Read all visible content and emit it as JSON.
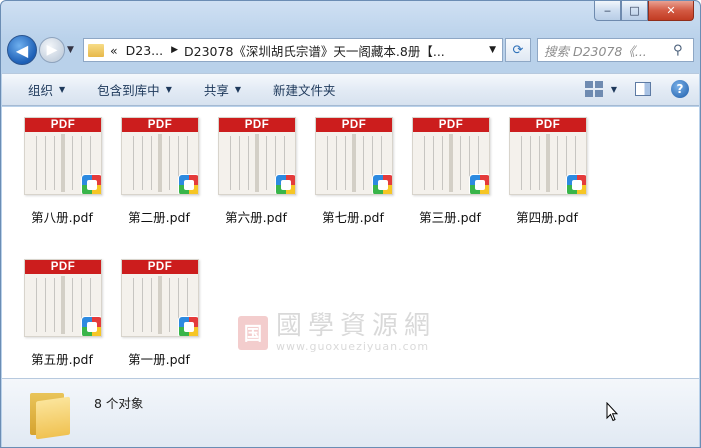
{
  "window": {
    "controls": {
      "minimize": "‒",
      "maximize": "□",
      "close": "✕"
    }
  },
  "navigation": {
    "back_icon": "back-arrow-icon",
    "forward_icon": "forward-arrow-icon",
    "breadcrumb": [
      {
        "label": "«"
      },
      {
        "label": "D23..."
      },
      {
        "label": "D23078《深圳胡氏宗谱》天一阁藏本.8册【..."
      }
    ],
    "search_placeholder": "搜索 D23078《..."
  },
  "toolbar": {
    "items": [
      {
        "label": "组织",
        "has_dropdown": true
      },
      {
        "label": "包含到库中",
        "has_dropdown": true
      },
      {
        "label": "共享",
        "has_dropdown": true
      },
      {
        "label": "新建文件夹",
        "has_dropdown": false
      }
    ],
    "help_label": "?"
  },
  "files": [
    {
      "name": "第八册.pdf",
      "badge": "PDF"
    },
    {
      "name": "第二册.pdf",
      "badge": "PDF"
    },
    {
      "name": "第六册.pdf",
      "badge": "PDF"
    },
    {
      "name": "第七册.pdf",
      "badge": "PDF"
    },
    {
      "name": "第三册.pdf",
      "badge": "PDF"
    },
    {
      "name": "第四册.pdf",
      "badge": "PDF"
    },
    {
      "name": "第五册.pdf",
      "badge": "PDF"
    },
    {
      "name": "第一册.pdf",
      "badge": "PDF"
    }
  ],
  "watermark": {
    "seal": "国",
    "text_cn": "國學資源網",
    "url": "www.guoxueziyuan.com"
  },
  "status": {
    "count_text": "8 个对象"
  },
  "colors": {
    "pdf_band": "#cc1d1d",
    "frame": "#b9d1ea",
    "toolbar_text": "#1e395b"
  }
}
